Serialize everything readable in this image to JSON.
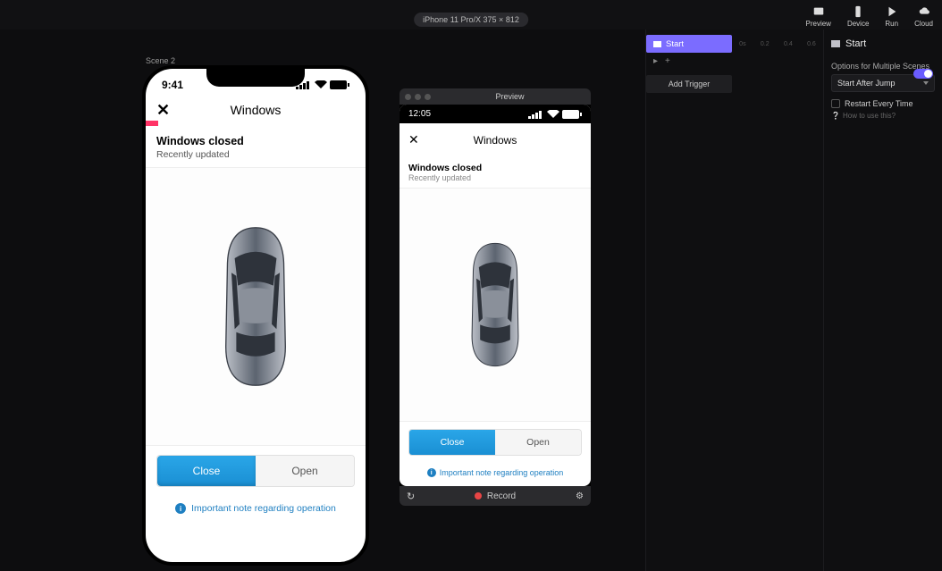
{
  "topbar": {
    "device_chip": "iPhone 11 Pro/X  375 × 812",
    "buttons": {
      "preview": "Preview",
      "device": "Device",
      "run": "Run",
      "cloud": "Cloud"
    }
  },
  "canvas": {
    "scene_label": "Scene 2",
    "device1": {
      "time": "9:41",
      "header_title": "Windows",
      "sub_title": "Windows closed",
      "sub_caption": "Recently updated",
      "btn_close": "Close",
      "btn_open": "Open",
      "note": "Important note regarding operation"
    },
    "preview": {
      "title": "Preview",
      "time": "12:05",
      "header_title": "Windows",
      "sub_title": "Windows closed",
      "sub_caption": "Recently updated",
      "btn_close": "Close",
      "btn_open": "Open",
      "note": "Important note regarding operation",
      "record": "Record"
    }
  },
  "scenes_panel": {
    "start_label": "Start",
    "timeline": [
      "0s",
      "0.2",
      "0.4",
      "0.6"
    ],
    "add_trigger": "Add Trigger"
  },
  "inspector": {
    "title": "Start",
    "options_label": "Options for Multiple Scenes",
    "select_value": "Start After Jump",
    "restart_label": "Restart Every Time",
    "hint": "How to use this?"
  }
}
